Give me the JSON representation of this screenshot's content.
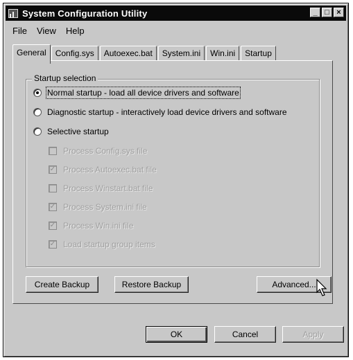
{
  "window": {
    "title": "System Configuration Utility"
  },
  "title_buttons": {
    "minimize": "_",
    "maximize": "□",
    "close": "×"
  },
  "menu": {
    "items": [
      "File",
      "View",
      "Help"
    ]
  },
  "tabs": [
    "General",
    "Config.sys",
    "Autoexec.bat",
    "System.ini",
    "Win.ini",
    "Startup"
  ],
  "active_tab": "General",
  "group": {
    "label": "Startup selection",
    "radios": [
      {
        "label": "Normal startup - load all device drivers and software",
        "selected": true
      },
      {
        "label": "Diagnostic startup - interactively load device drivers and software",
        "selected": false
      },
      {
        "label": "Selective startup",
        "selected": false
      }
    ],
    "checkboxes": [
      {
        "label": "Process Config.sys file",
        "checked": false
      },
      {
        "label": "Process Autoexec.bat file",
        "checked": true
      },
      {
        "label": "Process Winstart.bat file",
        "checked": false
      },
      {
        "label": "Process System.ini file",
        "checked": true
      },
      {
        "label": "Process Win.ini file",
        "checked": true
      },
      {
        "label": "Load startup group items",
        "checked": true
      }
    ]
  },
  "buttons": {
    "create_backup": "Create Backup",
    "restore_backup": "Restore Backup",
    "advanced": "Advanced...",
    "ok": "OK",
    "cancel": "Cancel",
    "apply": "Apply"
  }
}
